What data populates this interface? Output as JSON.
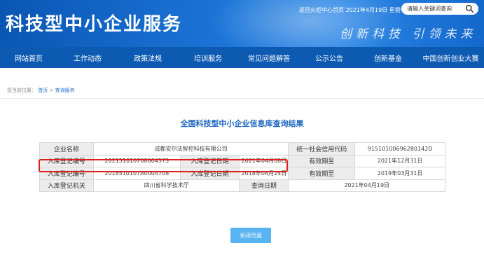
{
  "header": {
    "brand": "科技型中小企业服务",
    "top_links": "返回火炬中心首页  2021年4月19日 星期一",
    "search_placeholder": "请输入关键词查询",
    "slogan": "创新科技 引领未来"
  },
  "nav": {
    "items": [
      "网站首页",
      "工作动态",
      "政策法规",
      "培训服务",
      "常见问题解答",
      "公示公告",
      "创新基金",
      "中国创新创业大赛"
    ]
  },
  "breadcrumb": {
    "prefix": "您当前位置：",
    "home": "首页",
    "separator": ">",
    "current": "查询服务"
  },
  "result": {
    "title": "全国科技型中小企业信息库查询结果",
    "rows": [
      [
        "企业名称",
        "成都安尔法智控科技有限公司",
        "",
        "",
        "统一社会信用代码",
        "91510100696280142D"
      ],
      [
        "入库登记编号",
        "202151010708004573",
        "入库登记日期",
        "2021年04月08日",
        "有效期至",
        "2021年12月31日"
      ],
      [
        "入库登记编号",
        "2018510107A0004708",
        "入库登记日期",
        "2018年08月24日",
        "有效期至",
        "2019年03月31日"
      ],
      [
        "入库登记机关",
        "四川省科学技术厅",
        "",
        "查询日期",
        "2021年04月19日",
        ""
      ]
    ]
  },
  "actions": {
    "close_label": "关闭页面"
  },
  "colors": {
    "header_blue": "#1468cc",
    "nav_blue": "#0c5ab2",
    "title_blue": "#1a64c0",
    "highlight_red": "#e0201a",
    "button_blue": "#57b4f0"
  }
}
